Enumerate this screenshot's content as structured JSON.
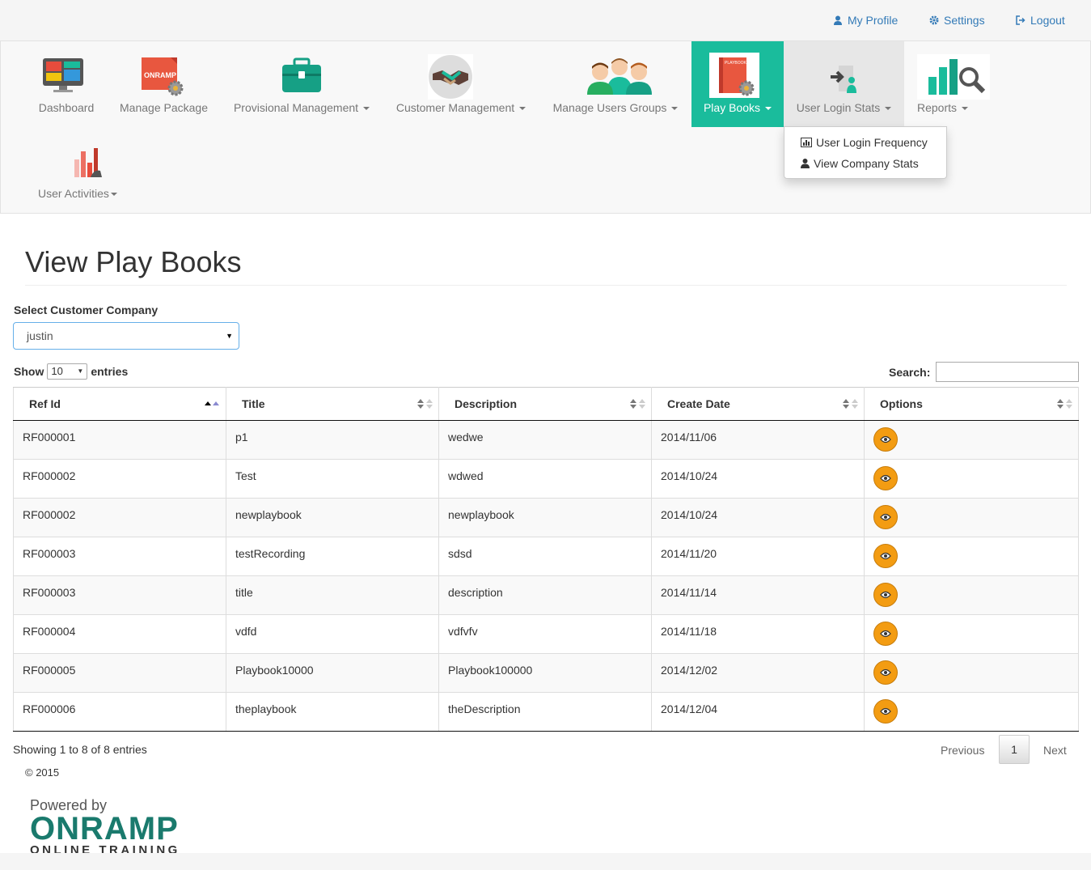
{
  "top_links": {
    "profile": "My Profile",
    "settings": "Settings",
    "logout": "Logout"
  },
  "nav": {
    "dashboard": "Dashboard",
    "manage_package": "Manage Package",
    "manage_package_icon_text": "ONRAMP",
    "provisional": "Provisional Management",
    "customer": "Customer Management",
    "users_groups": "Manage Users Groups",
    "play_books": "Play Books",
    "play_books_icon_text": "PLAYBOOK",
    "login_stats": "User Login Stats",
    "reports": "Reports",
    "user_activities": "User Activities"
  },
  "dropdown": {
    "item1": "User Login Frequency",
    "item2": "View Company Stats"
  },
  "page": {
    "title": "View Play Books",
    "select_label": "Select Customer Company",
    "selected_company": "justin",
    "show": "Show",
    "entries_value": "10",
    "entries": "entries",
    "search_label": "Search:"
  },
  "table": {
    "headers": [
      "Ref Id",
      "Title",
      "Description",
      "Create Date",
      "Options"
    ],
    "rows": [
      {
        "ref": "RF000001",
        "title": "p1",
        "desc": "wedwe",
        "date": "2014/11/06"
      },
      {
        "ref": "RF000002",
        "title": "Test",
        "desc": "wdwed",
        "date": "2014/10/24"
      },
      {
        "ref": "RF000002",
        "title": "newplaybook",
        "desc": "newplaybook",
        "date": "2014/10/24"
      },
      {
        "ref": "RF000003",
        "title": "testRecording",
        "desc": "sdsd",
        "date": "2014/11/20"
      },
      {
        "ref": "RF000003",
        "title": "title",
        "desc": "description",
        "date": "2014/11/14"
      },
      {
        "ref": "RF000004",
        "title": "vdfd",
        "desc": "vdfvfv",
        "date": "2014/11/18"
      },
      {
        "ref": "RF000005",
        "title": "Playbook10000",
        "desc": "Playbook100000",
        "date": "2014/12/02"
      },
      {
        "ref": "RF000006",
        "title": "theplaybook",
        "desc": "theDescription",
        "date": "2014/12/04"
      }
    ]
  },
  "pagination": {
    "info": "Showing 1 to 8 of 8 entries",
    "previous": "Previous",
    "page": "1",
    "next": "Next"
  },
  "footer": {
    "copyright": "© 2015",
    "powered_by": "Powered by",
    "brand": "ONRAMP",
    "tagline": "ONLINE TRAINING"
  },
  "colors": {
    "accent": "#1abc9c",
    "link": "#337ab7",
    "eye_button": "#f39c12",
    "brand": "#1a7a6d"
  }
}
